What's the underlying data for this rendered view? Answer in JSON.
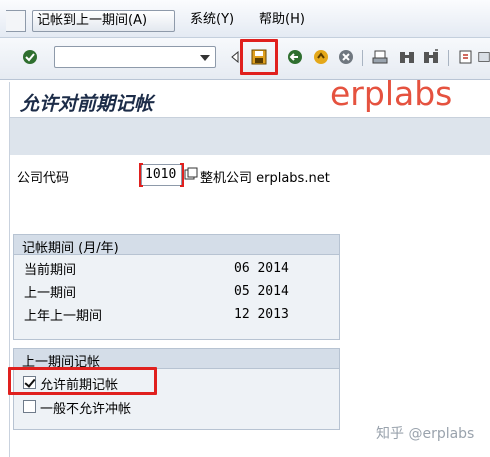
{
  "menubar": {
    "items": [
      {
        "label": "记帐到上一期间(A)"
      },
      {
        "label": "系统(Y)"
      },
      {
        "label": "帮助(H)"
      }
    ]
  },
  "toolbar": {
    "command_field_value": "",
    "icons": [
      "check-icon",
      "back-triangle-icon",
      "save-icon",
      "back-icon",
      "exit-icon",
      "cancel-icon",
      "print-icon",
      "find-icon",
      "find-next-icon",
      "new-session-icon",
      "layout-icon"
    ]
  },
  "watermark": "erplabs",
  "page": {
    "title": "允许对前期记帐"
  },
  "company": {
    "label": "公司代码",
    "value": "1010",
    "description": "整机公司 erplabs.net"
  },
  "posting_period_box": {
    "title": "记帐期间 (月/年)",
    "rows": [
      {
        "label": "当前期间",
        "value": "06 2014"
      },
      {
        "label": "上一期间",
        "value": "05 2014"
      },
      {
        "label": "上年上一期间",
        "value": "12 2013"
      }
    ]
  },
  "prev_period_box": {
    "title": "上一期间记帐",
    "options": [
      {
        "label": "允许前期记帐",
        "checked": true
      },
      {
        "label": "一般不允许冲帐",
        "checked": false
      }
    ]
  },
  "footer_watermark": "知乎 @erplabs",
  "colors": {
    "highlight": "#e0201e",
    "watermark": "#e5523f",
    "title": "#1c2c48",
    "group_header": "#d4dde8"
  }
}
